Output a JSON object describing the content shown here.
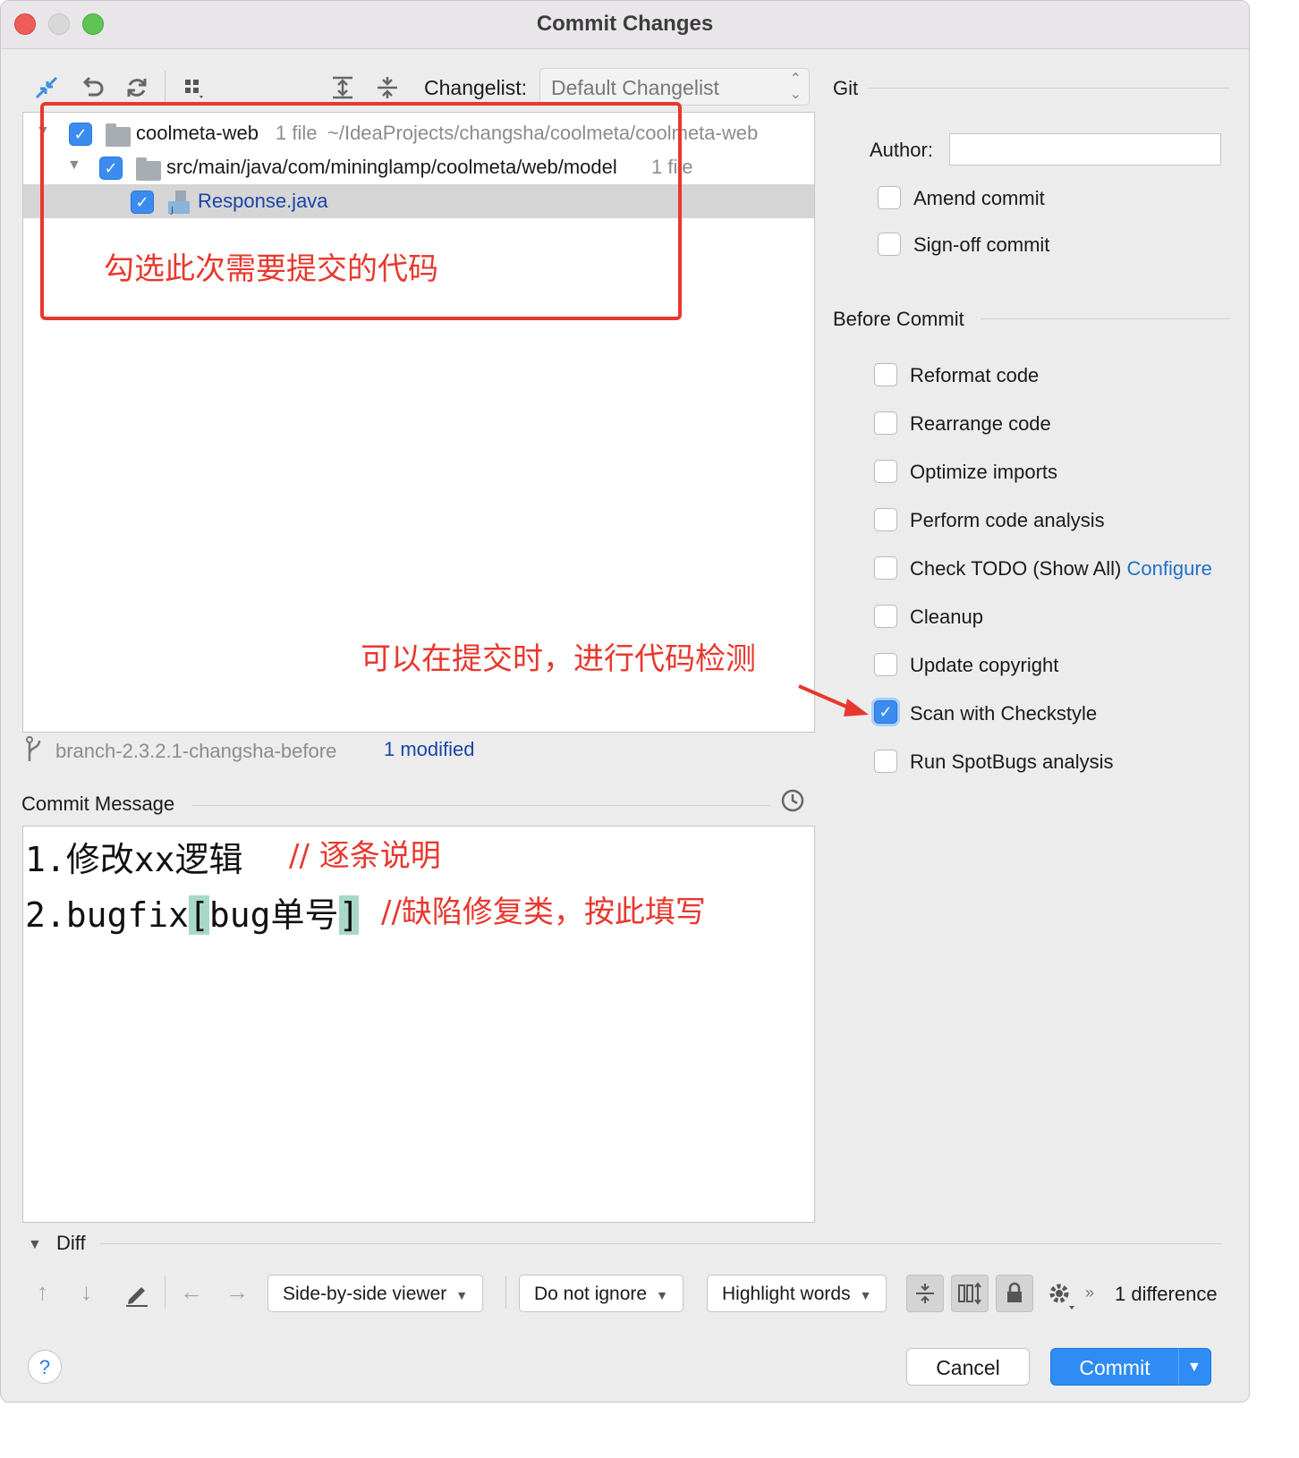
{
  "window": {
    "title": "Commit Changes"
  },
  "toolbar": {
    "changelist_label": "Changelist:",
    "changelist_value": "Default Changelist"
  },
  "tree": {
    "rows": [
      {
        "name": "coolmeta-web",
        "count": "1 file",
        "path": "~/IdeaProjects/changsha/coolmeta/coolmeta-web"
      },
      {
        "name": "src/main/java/com/mininglamp/coolmeta/web/model",
        "count": "1 file"
      },
      {
        "name": "Response.java"
      }
    ]
  },
  "annotations": {
    "select_code": "勾选此次需要提交的代码",
    "code_check": "可以在提交时，进行代码检测",
    "msg_note1": "// 逐条说明",
    "msg_note2": "//缺陷修复类，按此填写"
  },
  "branch": {
    "name": "branch-2.3.2.1-changsha-before",
    "modified": "1 modified"
  },
  "commit_message": {
    "label": "Commit Message",
    "line1": "1.修改xx逻辑",
    "line2_prefix": "2.bugfix",
    "line2_open": "[",
    "line2_mid": "bug单号",
    "line2_close": "]"
  },
  "git": {
    "section": "Git",
    "author_label": "Author:",
    "author_value": "",
    "amend": "Amend commit",
    "signoff": "Sign-off commit"
  },
  "before_commit": {
    "section": "Before Commit",
    "items": [
      {
        "label": "Reformat code",
        "checked": false
      },
      {
        "label": "Rearrange code",
        "checked": false
      },
      {
        "label": "Optimize imports",
        "checked": false
      },
      {
        "label": "Perform code analysis",
        "checked": false
      },
      {
        "label": "Check TODO (Show All)",
        "checked": false
      },
      {
        "label": "Cleanup",
        "checked": false
      },
      {
        "label": "Update copyright",
        "checked": false
      },
      {
        "label": "Scan with Checkstyle",
        "checked": true
      },
      {
        "label": "Run SpotBugs analysis",
        "checked": false
      }
    ],
    "configure_link": "Configure"
  },
  "diff": {
    "section": "Diff",
    "viewer": "Side-by-side viewer",
    "ignore": "Do not ignore",
    "highlight": "Highlight words",
    "count": "1 difference"
  },
  "buttons": {
    "cancel": "Cancel",
    "commit": "Commit",
    "help": "?"
  },
  "colors": {
    "accent": "#2e8cf4",
    "annotation": "#e8382e",
    "link": "#2470c8"
  }
}
